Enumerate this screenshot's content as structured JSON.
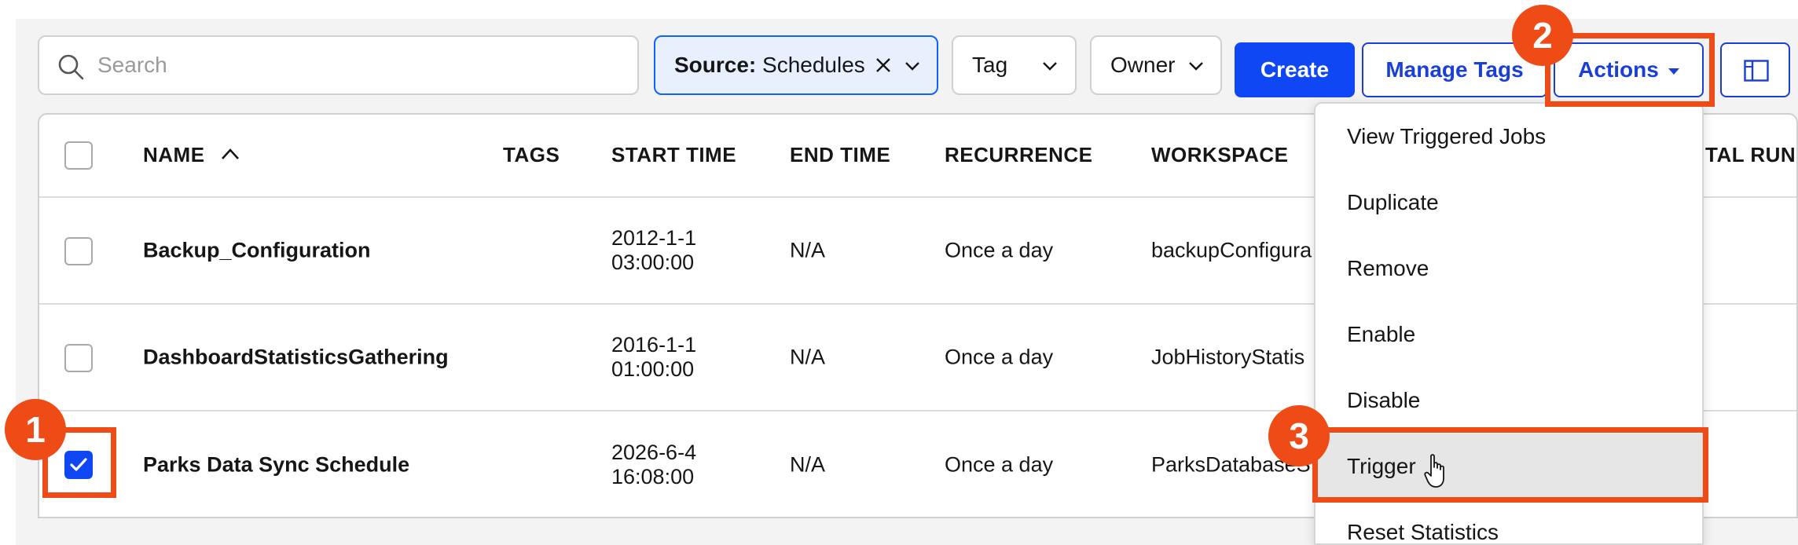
{
  "toolbar": {
    "search_placeholder": "Search",
    "source_filter": {
      "label": "Source:",
      "value": "Schedules"
    },
    "tag_filter": "Tag",
    "owner_filter": "Owner",
    "create_label": "Create",
    "manage_tags_label": "Manage Tags",
    "actions_label": "Actions"
  },
  "table": {
    "columns": [
      "NAME",
      "TAGS",
      "START TIME",
      "END TIME",
      "RECURRENCE",
      "WORKSPACE",
      "TAL RUN"
    ],
    "rows": [
      {
        "name": "Backup_Configuration",
        "start_date": "2012-1-1",
        "start_time": "03:00:00",
        "end_time": "N/A",
        "recurrence": "Once a day",
        "workspace": "backupConfigura",
        "checked": false
      },
      {
        "name": "DashboardStatisticsGathering",
        "start_date": "2016-1-1",
        "start_time": "01:00:00",
        "end_time": "N/A",
        "recurrence": "Once a day",
        "workspace": "JobHistoryStatis",
        "checked": false
      },
      {
        "name": "Parks Data Sync Schedule",
        "start_date": "2026-6-4",
        "start_time": "16:08:00",
        "end_time": "N/A",
        "recurrence": "Once a day",
        "workspace": "ParksDatabaseS",
        "checked": true
      }
    ]
  },
  "actions_menu": {
    "items": [
      "View Triggered Jobs",
      "Duplicate",
      "Remove",
      "Enable",
      "Disable",
      "Trigger",
      "Reset Statistics"
    ],
    "highlighted": "Trigger"
  },
  "annotations": {
    "badges": [
      "1",
      "2",
      "3"
    ],
    "color": "#ef4b16"
  },
  "colors": {
    "primary": "#0f47f5",
    "link": "#1a3fd6"
  }
}
